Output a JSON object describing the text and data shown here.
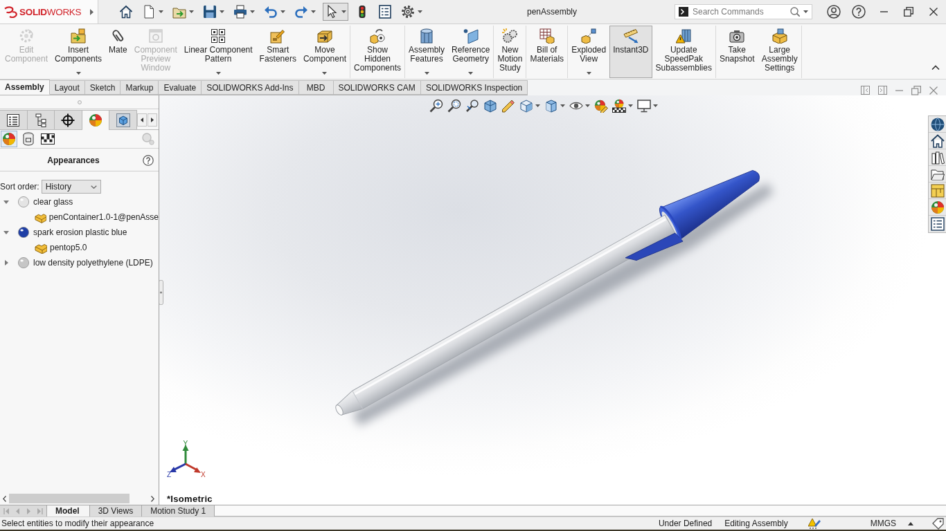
{
  "app": {
    "logo": "**SOLID**WORKS"
  },
  "quick_access": [
    {
      "dropdown": false,
      "selected": false
    },
    {
      "dropdown": true,
      "selected": false
    },
    {
      "dropdown": true,
      "selected": false
    },
    {
      "dropdown": true,
      "selected": false
    },
    {
      "dropdown": true,
      "selected": false
    },
    {
      "dropdown": true,
      "selected": false
    },
    {
      "dropdown": true,
      "selected": false
    },
    {
      "dropdown": true,
      "selected": true
    },
    {
      "dropdown": false,
      "selected": false
    },
    {
      "dropdown": false,
      "selected": false
    },
    {
      "dropdown": true,
      "selected": false
    }
  ],
  "window": {
    "title": "penAssembly"
  },
  "search": {
    "placeholder": "Search Commands"
  },
  "ribbon": {
    "groups": [
      {
        "buttons": [
          {
            "label": "Edit\nComponent",
            "disabled": true,
            "dropdown": false,
            "selected": false
          },
          {
            "label": "Insert\nComponents",
            "disabled": false,
            "dropdown": true,
            "selected": false
          },
          {
            "label": "Mate",
            "disabled": false,
            "dropdown": false,
            "selected": false
          },
          {
            "label": "Component\nPreview\nWindow",
            "disabled": true,
            "dropdown": false,
            "selected": false
          },
          {
            "label": "Linear Component\nPattern",
            "disabled": false,
            "dropdown": true,
            "selected": false
          },
          {
            "label": "Smart\nFasteners",
            "disabled": false,
            "dropdown": false,
            "selected": false
          },
          {
            "label": "Move\nComponent",
            "disabled": false,
            "dropdown": true,
            "selected": false
          }
        ]
      },
      {
        "buttons": [
          {
            "label": "Show\nHidden\nComponents",
            "disabled": false,
            "dropdown": false,
            "selected": false
          }
        ]
      },
      {
        "buttons": [
          {
            "label": "Assembly\nFeatures",
            "disabled": false,
            "dropdown": true,
            "selected": false
          },
          {
            "label": "Reference\nGeometry",
            "disabled": false,
            "dropdown": true,
            "selected": false
          }
        ]
      },
      {
        "buttons": [
          {
            "label": "New\nMotion\nStudy",
            "disabled": false,
            "dropdown": false,
            "selected": false
          }
        ]
      },
      {
        "buttons": [
          {
            "label": "Bill of\nMaterials",
            "disabled": false,
            "dropdown": false,
            "selected": false
          }
        ]
      },
      {
        "buttons": [
          {
            "label": "Exploded\nView",
            "disabled": false,
            "dropdown": true,
            "selected": false
          },
          {
            "label": "Instant3D",
            "disabled": false,
            "dropdown": false,
            "selected": true
          },
          {
            "label": "Update\nSpeedPak\nSubassemblies",
            "disabled": false,
            "dropdown": false,
            "selected": false
          }
        ]
      },
      {
        "buttons": [
          {
            "label": "Take\nSnapshot",
            "disabled": false,
            "dropdown": false,
            "selected": false
          },
          {
            "label": "Large\nAssembly\nSettings",
            "disabled": false,
            "dropdown": false,
            "selected": false
          }
        ]
      }
    ]
  },
  "command_tabs": [
    {
      "label": "Assembly",
      "selected": true
    },
    {
      "label": "Layout",
      "selected": false
    },
    {
      "label": "Sketch",
      "selected": false
    },
    {
      "label": "Markup",
      "selected": false
    },
    {
      "label": "Evaluate",
      "selected": false
    },
    {
      "label": "SOLIDWORKS Add-Ins",
      "selected": false
    },
    {
      "label": "MBD",
      "selected": false
    },
    {
      "label": "SOLIDWORKS CAM",
      "selected": false
    },
    {
      "label": "SOLIDWORKS Inspection",
      "selected": false
    }
  ],
  "feature_manager": {
    "tabs": [
      {
        "selected": false
      },
      {
        "selected": false
      },
      {
        "selected": false
      },
      {
        "selected": true
      },
      {
        "selected": false
      }
    ],
    "filters": [
      {
        "selected": true
      },
      {
        "selected": false
      },
      {
        "selected": false
      }
    ],
    "title": "Appearances",
    "sort_order": {
      "label": "Sort order:",
      "value": "History"
    },
    "tree": [
      {
        "label": "clear glass",
        "color": "#e4e4e4",
        "expanded": true,
        "children": [
          {
            "label": "penContainer1.0-1@penAsse"
          }
        ]
      },
      {
        "label": "spark erosion plastic blue",
        "color": "#1f3fa6",
        "expanded": true,
        "children": [
          {
            "label": "pentop5.0"
          }
        ]
      },
      {
        "label": "low density polyethylene (LDPE)",
        "color": "#c6c6c6",
        "expanded": false
      }
    ]
  },
  "viewport": {
    "view_toolbar": [
      {
        "dropdown": false
      },
      {
        "dropdown": false
      },
      {
        "dropdown": false
      },
      {
        "dropdown": false
      },
      {
        "dropdown": false
      },
      {
        "dropdown": true
      },
      {
        "dropdown": true
      },
      {
        "dropdown": true
      },
      {
        "dropdown": false
      },
      {
        "dropdown": true
      },
      {
        "dropdown": true
      }
    ],
    "triad_axes": [
      {
        "label": "Y",
        "color": "#2f8a3a"
      },
      {
        "label": "Z",
        "color": "#2838a8"
      },
      {
        "label": "X",
        "color": "#c0392b"
      }
    ],
    "view_name": "*Isometric"
  },
  "bottom_tabs": [
    {
      "label": "Model",
      "selected": true
    },
    {
      "label": "3D Views",
      "selected": false
    },
    {
      "label": "Motion Study 1",
      "selected": false
    }
  ],
  "status_bar": {
    "message": "Select entities to modify their appearance",
    "state": "Under Defined",
    "mode": "Editing Assembly",
    "units": "MMGS"
  }
}
